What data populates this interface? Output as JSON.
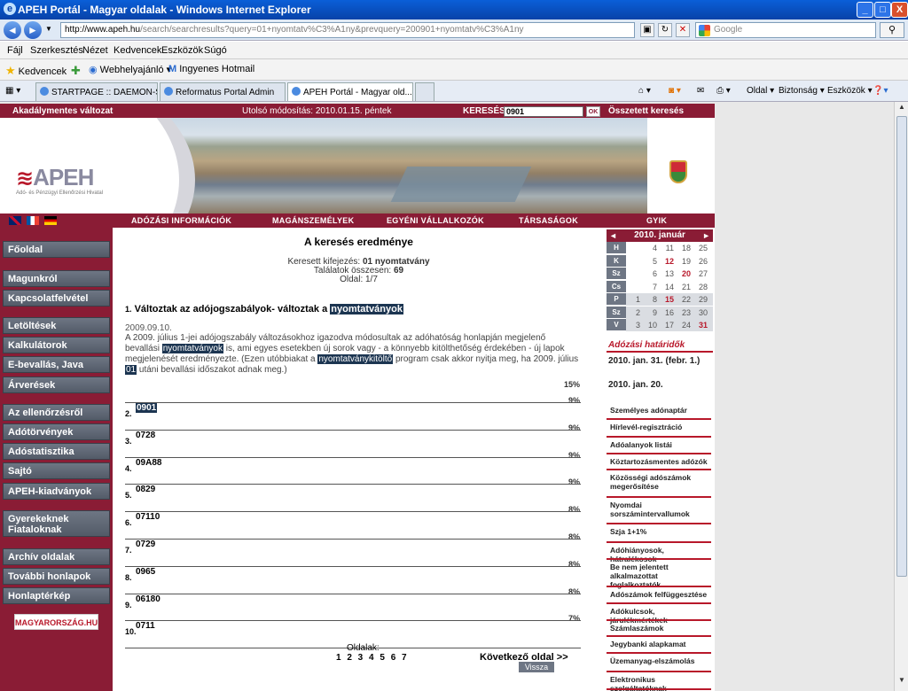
{
  "window": {
    "title": "APEH Portál - Magyar oldalak - Windows Internet Explorer",
    "minimize": "_",
    "maximize": "□",
    "close": "X"
  },
  "address": {
    "url_host": "http://www.apeh.hu",
    "url_rest": "/search/searchresults?query=01+nyomtatv%C3%A1ny&prevquery=200901+nyomtatv%C3%A1ny",
    "search_placeholder": "Google"
  },
  "menu": [
    "Fájl",
    "Szerkesztés",
    "Nézet",
    "Kedvencek",
    "Eszközök",
    "Súgó"
  ],
  "favorites": {
    "kedvencek": "Kedvencek",
    "webhelyajanlo": "Webhelyajánló",
    "hotmail": "Ingyenes Hotmail"
  },
  "tabs": [
    {
      "label": "STARTPAGE :: DAEMON-Sea..."
    },
    {
      "label": "Reformatus Portal Admin"
    },
    {
      "label": "APEH Portál - Magyar old..."
    }
  ],
  "commandbar": {
    "oldal": "Oldal",
    "biztonsag": "Biztonság",
    "eszkozok": "Eszközök"
  },
  "site": {
    "accessible": "Akadálymentes változat",
    "modified": "Utolsó módosítás: 2010.01.15.  péntek",
    "search_label": "KERESÉS",
    "search_value": "0901",
    "ok": "OK",
    "advanced": "Összetett keresés",
    "logo": "APEH",
    "logo_sub": "Adó- és Pénzügyi Ellenőrzési Hivatal",
    "nav": [
      "ADÓZÁSI INFORMÁCIÓK",
      "MAGÁNSZEMÉLYEK",
      "EGYÉNI VÁLLALKOZÓK",
      "TÁRSASÁGOK",
      "GYIK"
    ],
    "left_menu": [
      "Főoldal",
      "Magunkról",
      "Kapcsolatfelvétel",
      "Letöltések",
      "Kalkulátorok",
      "E-bevallás, Java",
      "Árverések",
      "Az ellenőrzésről",
      "Adótörvények",
      "Adóstatisztika",
      "Sajtó",
      "APEH-kiadványok",
      "Gyerekeknek Fiataloknak",
      "Archív oldalak",
      "További honlapok",
      "Honlaptérkép"
    ],
    "magyarorszag": "MAGYARORSZÁG.HU"
  },
  "results": {
    "title": "A keresés eredménye",
    "searched_label": "Keresett kifejezés:",
    "searched_value": "01 nyomtatvány",
    "total_label": "Találatok összesen:",
    "total_value": "69",
    "page_label": "Oldal:",
    "page_value": "1/7",
    "first": {
      "num": "1.",
      "title_pre": "Változtak az adójogszabályok- változtak a",
      "title_hl": "nyomtatványok",
      "date": "2009.09.10.",
      "snippet_1": "A 2009. július 1-jei adójogszabály változásokhoz igazodva módosultak az adóhatóság honlapján megjelenő bevallási",
      "snippet_hl1": "nyomtatványok",
      "snippet_2": "is, ami egyes esetekben új sorok vagy - a könnyebb kitölthetőség érdekében - új lapok megjelenését eredményezte. (Ezen utóbbiakat a",
      "snippet_hl2": "nyomtatványkitöltő",
      "snippet_3": "program csak akkor nyitja meg, ha 2009. július",
      "snippet_hl3": "01",
      "snippet_4": "utáni bevallási időszakot adnak meg.)",
      "pct": "15%"
    },
    "items": [
      {
        "num": "2.",
        "value": "0901",
        "pct": "9%"
      },
      {
        "num": "3.",
        "value": "0728",
        "pct": "9%"
      },
      {
        "num": "4.",
        "value": "09A88",
        "pct": "9%"
      },
      {
        "num": "5.",
        "value": "0829",
        "pct": "9%"
      },
      {
        "num": "6.",
        "value": "07110",
        "pct": "8%"
      },
      {
        "num": "7.",
        "value": "0729",
        "pct": "8%"
      },
      {
        "num": "8.",
        "value": "0965",
        "pct": "8%"
      },
      {
        "num": "9.",
        "value": "06180",
        "pct": "8%"
      },
      {
        "num": "10.",
        "value": "0711",
        "pct": "7%"
      }
    ],
    "pager_label": "Oldalak:",
    "pager": "1 2 3 4 5 6 7",
    "next": "Következő oldal >>",
    "back": "Vissza"
  },
  "calendar": {
    "month": "2010. január",
    "prev": "◄",
    "next": "►",
    "days": [
      "H",
      "K",
      "Sz",
      "Cs",
      "P",
      "Sz",
      "V"
    ],
    "rows": [
      [
        "",
        "4",
        "11",
        "18",
        "25"
      ],
      [
        "",
        "5",
        "12",
        "19",
        "26"
      ],
      [
        "",
        "6",
        "13",
        "20",
        "27"
      ],
      [
        "",
        "7",
        "14",
        "21",
        "28"
      ],
      [
        "1",
        "8",
        "15",
        "22",
        "29"
      ],
      [
        "2",
        "9",
        "16",
        "23",
        "30"
      ],
      [
        "3",
        "10",
        "17",
        "24",
        "31"
      ]
    ]
  },
  "deadlines": {
    "title": "Adózási határidők",
    "d1": "2010. jan. 31. (febr. 1.)",
    "d2": "2010. jan. 20."
  },
  "right_links": [
    "Személyes adónaptár",
    "Hírlevél-regisztráció",
    "Adóalanyok listái",
    "Köztartozásmentes adózók",
    "Közösségi adószámok megerősítése",
    "Nyomdai sorszámintervallumok",
    "Szja 1+1%",
    "Adóhiányosok, hátralékosok",
    "Be nem jelentett alkalmazottat foglalkoztatók",
    "Adószámok felfüggesztése",
    "Adókulcsok, járulékmértékek",
    "Számlaszámok",
    "Jegybanki alapkamat",
    "Üzemanyag-elszámolás",
    "Elektronikus szolgáltatóknak"
  ]
}
